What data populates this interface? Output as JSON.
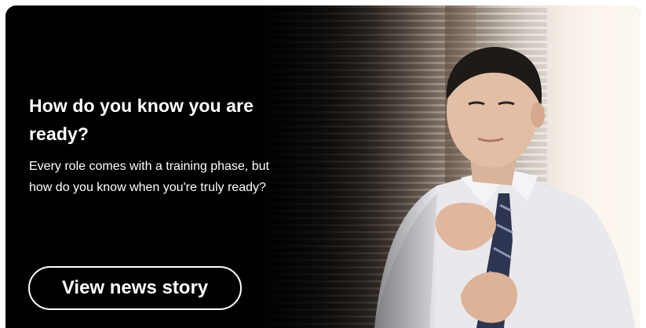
{
  "card": {
    "headline": "How do you know you are ready?",
    "description": "Every role comes with a training phase, but how do you know when you're truly ready?",
    "cta_label": "View news story"
  },
  "image": {
    "subject": "man-adjusting-tie-photo"
  },
  "colors": {
    "text": "#ffffff",
    "overlay": "#000000"
  }
}
